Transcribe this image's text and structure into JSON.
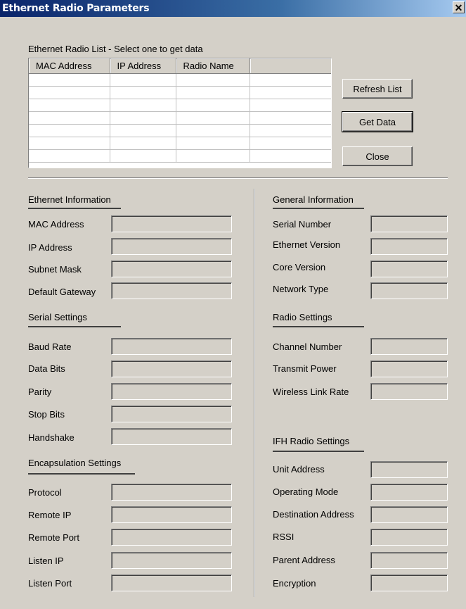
{
  "window": {
    "title": "Ethernet Radio Parameters",
    "close_glyph": "✕"
  },
  "radio_list": {
    "caption": "Ethernet Radio List - Select one to get data",
    "columns": [
      "MAC Address",
      "IP Address",
      "Radio Name",
      ""
    ],
    "rows": [
      [
        "",
        "",
        "",
        ""
      ],
      [
        "",
        "",
        "",
        ""
      ],
      [
        "",
        "",
        "",
        ""
      ],
      [
        "",
        "",
        "",
        ""
      ],
      [
        "",
        "",
        "",
        ""
      ],
      [
        "",
        "",
        "",
        ""
      ],
      [
        "",
        "",
        "",
        ""
      ]
    ]
  },
  "buttons": {
    "refresh": "Refresh List",
    "get_data": "Get Data",
    "close": "Close"
  },
  "ethernet_info": {
    "heading": "Ethernet Information",
    "fields": [
      {
        "label": "MAC Address",
        "value": ""
      },
      {
        "label": "IP Address",
        "value": ""
      },
      {
        "label": "Subnet Mask",
        "value": ""
      },
      {
        "label": "Default Gateway",
        "value": ""
      }
    ]
  },
  "serial_settings": {
    "heading": "Serial Settings",
    "fields": [
      {
        "label": "Baud Rate",
        "value": ""
      },
      {
        "label": "Data Bits",
        "value": ""
      },
      {
        "label": "Parity",
        "value": ""
      },
      {
        "label": "Stop Bits",
        "value": ""
      },
      {
        "label": "Handshake",
        "value": ""
      }
    ]
  },
  "encapsulation_settings": {
    "heading": "Encapsulation Settings",
    "fields": [
      {
        "label": "Protocol",
        "value": ""
      },
      {
        "label": "Remote IP",
        "value": ""
      },
      {
        "label": "Remote Port",
        "value": ""
      },
      {
        "label": "Listen IP",
        "value": ""
      },
      {
        "label": "Listen Port",
        "value": ""
      }
    ]
  },
  "general_info": {
    "heading": "General Information",
    "fields": [
      {
        "label": "Serial Number",
        "value": ""
      },
      {
        "label": "Ethernet Version",
        "value": ""
      },
      {
        "label": "Core Version",
        "value": ""
      },
      {
        "label": "Network Type",
        "value": ""
      }
    ]
  },
  "radio_settings": {
    "heading": "Radio Settings",
    "fields": [
      {
        "label": "Channel Number",
        "value": ""
      },
      {
        "label": "Transmit Power",
        "value": ""
      },
      {
        "label": "Wireless Link Rate",
        "value": ""
      }
    ]
  },
  "ifh_radio_settings": {
    "heading": "IFH Radio Settings",
    "fields": [
      {
        "label": "Unit Address",
        "value": ""
      },
      {
        "label": "Operating Mode",
        "value": ""
      },
      {
        "label": "Destination Address",
        "value": ""
      },
      {
        "label": "RSSI",
        "value": ""
      },
      {
        "label": "Parent Address",
        "value": ""
      },
      {
        "label": "Encryption",
        "value": ""
      }
    ]
  }
}
